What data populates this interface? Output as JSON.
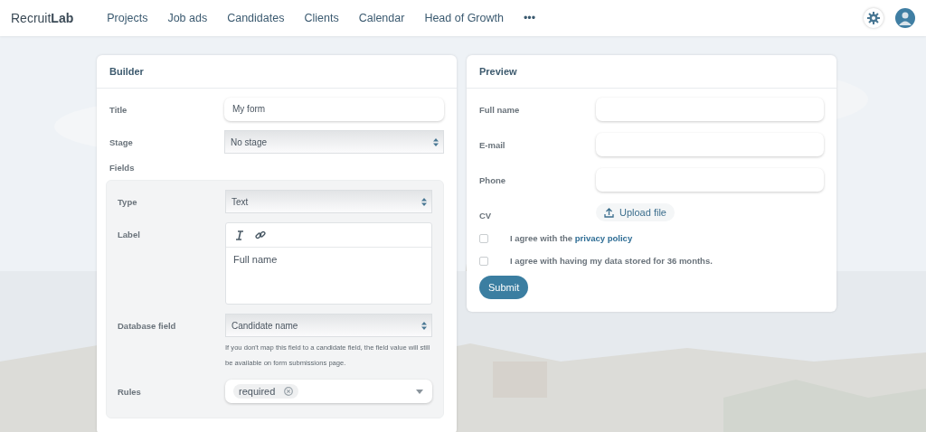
{
  "nav": {
    "brand": "Recruit**Lab**",
    "items": [
      {
        "label": "Projects"
      },
      {
        "label": "Job ads"
      },
      {
        "label": "Candidates"
      },
      {
        "label": "Clients"
      },
      {
        "label": "Calendar"
      },
      {
        "label": "Head of Growth"
      },
      {
        "label": "•••"
      }
    ]
  },
  "builder": {
    "title": "Builder",
    "rows": [
      {
        "label": "Title",
        "kind": "input",
        "value": "My form"
      },
      {
        "label": "Stage",
        "kind": "select",
        "value": "No stage"
      }
    ],
    "fields_heading": "Fields",
    "field": {
      "rows": [
        {
          "label": "Type",
          "kind": "select",
          "value": "Text"
        },
        {
          "label": "Label",
          "kind": "editor",
          "value": "Full name"
        },
        {
          "label": "Database field",
          "kind": "select",
          "value": "Candidate name",
          "help": "If you don't map this field to a candidate field, the field value will still be available on form submissions page."
        },
        {
          "label": "Rules",
          "kind": "tags",
          "tags": [
            "required"
          ]
        }
      ]
    }
  },
  "preview": {
    "title": "Preview",
    "fields": [
      {
        "label": "Full name",
        "kind": "input"
      },
      {
        "label": "E-mail",
        "kind": "input"
      },
      {
        "label": "Phone",
        "kind": "input"
      },
      {
        "label": "CV",
        "kind": "upload",
        "button": "Upload file"
      }
    ],
    "consents": [
      {
        "text": "I agree with the ",
        "link": "privacy policy",
        "checked": false
      },
      {
        "text": "I agree with having my data stored for 36 months.",
        "checked": false
      }
    ],
    "submit": "Submit"
  }
}
